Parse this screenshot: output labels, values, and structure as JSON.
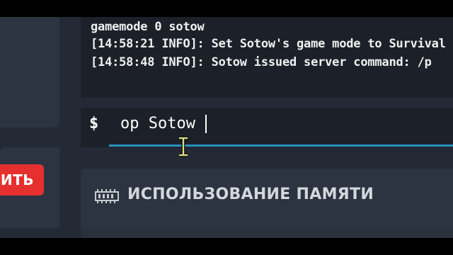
{
  "console": {
    "lines": [
      "gamemode 0 sotow",
      "[14:58:21 INFO]: Set Sotow's game mode to Survival",
      "[14:58:48 INFO]: Sotow issued server command: /p"
    ]
  },
  "input": {
    "prompt": "$",
    "value": "op Sotow"
  },
  "left_button": {
    "label": "ИТЬ"
  },
  "memory_panel": {
    "title": "ИСПОЛЬЗОВАНИЕ ПАМЯТИ",
    "icon": "memory-chip-icon"
  },
  "colors": {
    "accent_underline": "#2893bf",
    "danger_button": "#e5302f",
    "panel": "#2c3442",
    "console_bg": "#1c2129"
  }
}
